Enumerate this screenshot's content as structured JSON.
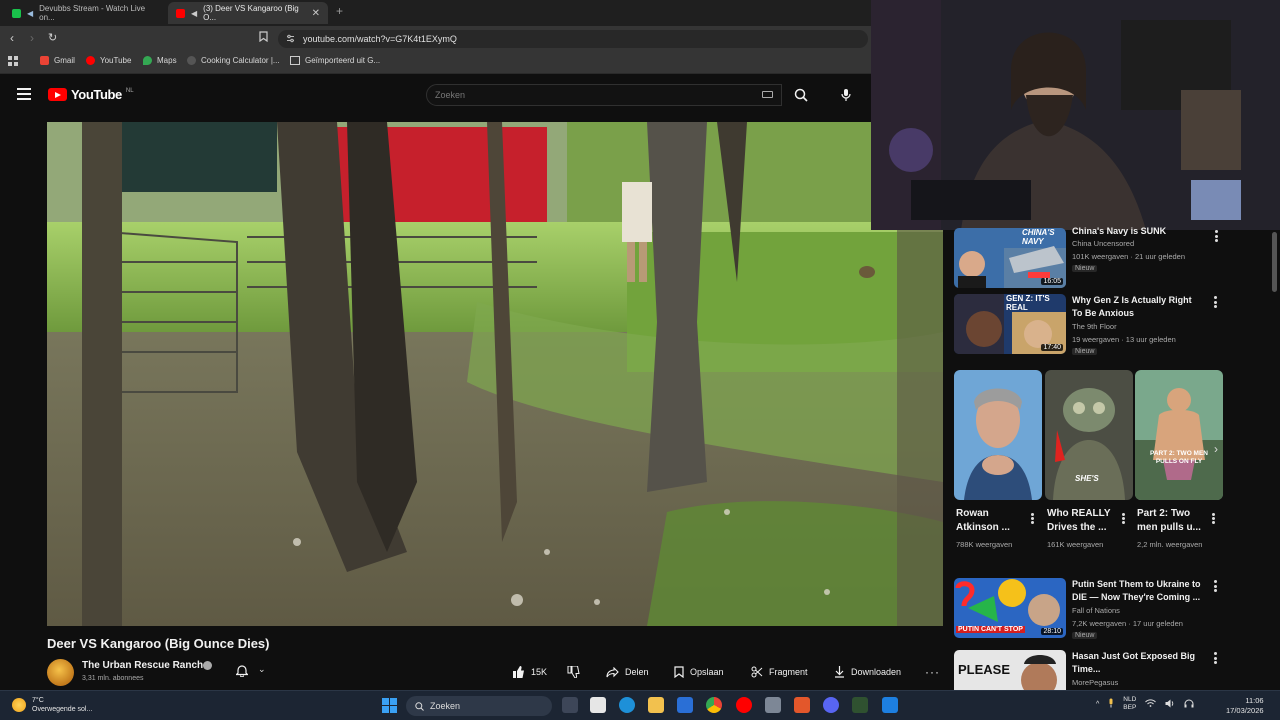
{
  "browser": {
    "tabs": [
      {
        "label": "Devubbs Stream - Watch Live on..."
      },
      {
        "label": "(3) Deer VS Kangaroo (Big O..."
      }
    ],
    "new_tab": "+",
    "url": "youtube.com/watch?v=G7K4t1EXymQ",
    "bookmarks": [
      {
        "label": "Gmail"
      },
      {
        "label": "YouTube"
      },
      {
        "label": "Maps"
      },
      {
        "label": "Cooking Calculator |..."
      },
      {
        "label": "Geïmporteerd uit G..."
      }
    ]
  },
  "youtube": {
    "logo_text": "YouTube",
    "logo_country": "NL",
    "search_placeholder": "Zoeken"
  },
  "video": {
    "title": "Deer VS Kangaroo (Big Ounce Dies)",
    "channel": "The Urban Rescue Ranch",
    "subscribers": "3,31 mln. abonnees",
    "likes": "15K",
    "actions": {
      "share": "Delen",
      "save": "Opslaan",
      "clip": "Fragment",
      "download": "Downloaden"
    }
  },
  "sidebar": {
    "recommendations": [
      {
        "title": "China's Navy is SUNK",
        "channel": "China Uncensored",
        "meta": "101K weergaven · 21 uur geleden",
        "badge": "Nieuw",
        "duration": "16:05",
        "thumb_text": "CHINA'S NAVY"
      },
      {
        "title": "Why Gen Z Is Actually Right To Be Anxious",
        "channel": "The 9th Floor",
        "meta": "19 weergaven · 13 uur geleden",
        "badge": "Nieuw",
        "duration": "17:40",
        "thumb_text": "GEN Z: IT'S REAL"
      },
      {
        "title": "Putin Sent Them to Ukraine to DIE — Now They're Coming ...",
        "channel": "Fall of Nations",
        "meta": "7,2K weergaven · 17 uur geleden",
        "badge": "Nieuw",
        "duration": "28:10",
        "thumb_text": "PUTIN CAN'T STOP"
      },
      {
        "title": "Hasan Just Got Exposed Big Time...",
        "channel": "MorePegasus",
        "thumb_text": "PLEASE"
      }
    ],
    "shorts": [
      {
        "title": "Rowan Atkinson ...",
        "views": "788K weergaven"
      },
      {
        "title": "Who REALLY Drives the ...",
        "views": "161K weergaven",
        "thumb_text": "SHE'S"
      },
      {
        "title": "Part 2: Two men pulls u...",
        "views": "2,2 mln. weergaven",
        "thumb_text": "PART 2: TWO MEN PULLS ON FLY"
      }
    ]
  },
  "taskbar": {
    "weather_temp": "7°C",
    "weather_desc": "Overwegende sol...",
    "search": "Zoeken",
    "lang_line1": "NLD",
    "lang_line2": "BEP",
    "time": "11:06",
    "date": "17/03/2026"
  },
  "colors": {
    "brand_red": "#ff0000",
    "background": "#0f0f0f",
    "taskbar": "#1c2533"
  }
}
